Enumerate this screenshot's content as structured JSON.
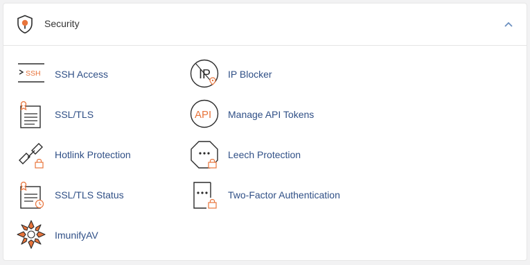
{
  "section": {
    "title": "Security",
    "header_icon": "shield-pin-icon",
    "collapse_icon": "chevron-up-icon"
  },
  "colors": {
    "accent": "#e8743b",
    "link": "#2f4f86",
    "icon_stroke": "#2b2b2b"
  },
  "items": [
    {
      "label": "SSH Access",
      "icon": "ssh-terminal-icon"
    },
    {
      "label": "IP Blocker",
      "icon": "ip-blocker-icon"
    },
    {
      "label": "SSL/TLS",
      "icon": "certificate-icon"
    },
    {
      "label": "Manage API Tokens",
      "icon": "api-token-icon"
    },
    {
      "label": "Hotlink Protection",
      "icon": "hotlink-lock-icon"
    },
    {
      "label": "Leech Protection",
      "icon": "leech-lock-icon"
    },
    {
      "label": "SSL/TLS Status",
      "icon": "certificate-status-icon"
    },
    {
      "label": "Two-Factor Authentication",
      "icon": "two-factor-lock-icon"
    },
    {
      "label": "ImunifyAV",
      "icon": "imunifyav-icon"
    }
  ]
}
